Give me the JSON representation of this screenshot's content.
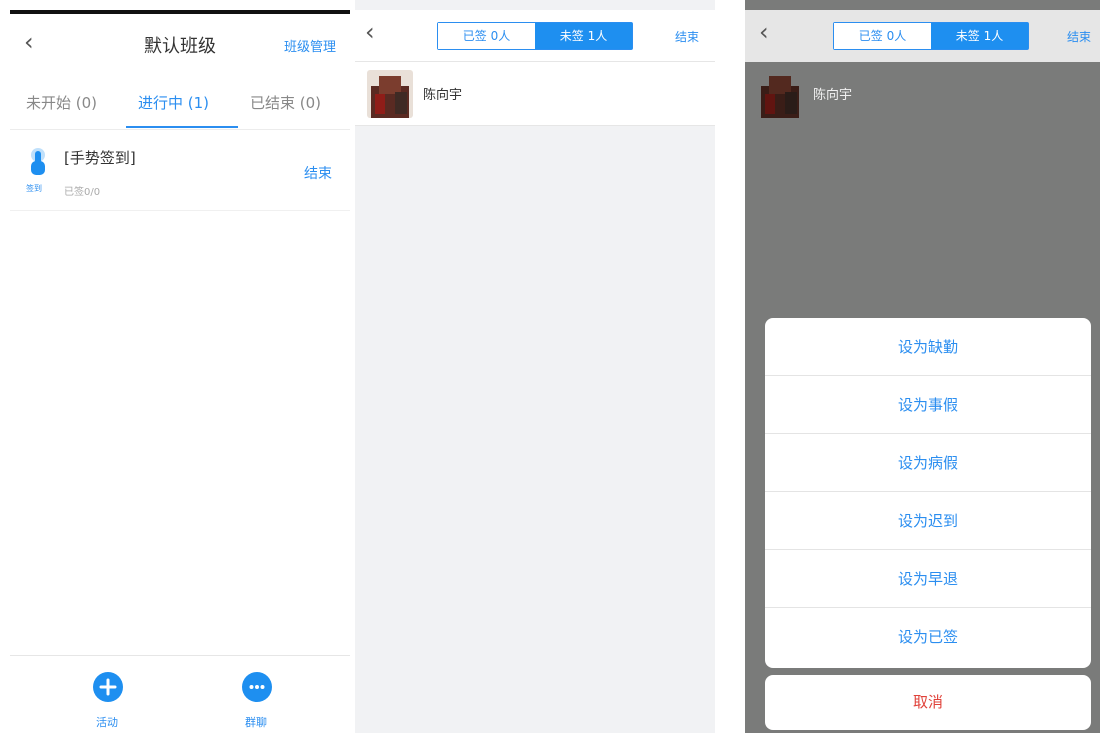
{
  "panel1": {
    "back_icon": "chevron-left-icon",
    "title": "默认班级",
    "manage_label": "班级管理",
    "tabs": [
      {
        "label": "未开始 (0)"
      },
      {
        "label": "进行中 (1)"
      },
      {
        "label": "已结束 (0)"
      }
    ],
    "activity": {
      "icon": "hand-tap-icon",
      "icon_label": "签到",
      "title": "[手势签到]",
      "sub": "已签0/0",
      "end_label": "结束"
    },
    "bottom": {
      "activity_label": "活动",
      "group_label": "群聊",
      "activity_icon": "plus-circle-icon",
      "group_icon": "chat-bubble-icon"
    }
  },
  "panel2": {
    "back_icon": "chevron-left-icon",
    "seg_signed": "已签 0人",
    "seg_unsigned": "未签 1人",
    "end_label": "结束",
    "student": {
      "name": "陈向宇",
      "avatar_icon": "avatar"
    }
  },
  "panel3": {
    "back_icon": "chevron-left-icon",
    "seg_signed": "已签 0人",
    "seg_unsigned": "未签 1人",
    "end_label": "结束",
    "student": {
      "name": "陈向宇"
    },
    "actions": [
      {
        "label": "设为缺勤"
      },
      {
        "label": "设为事假"
      },
      {
        "label": "设为病假"
      },
      {
        "label": "设为迟到"
      },
      {
        "label": "设为早退"
      },
      {
        "label": "设为已签"
      }
    ],
    "cancel_label": "取消"
  },
  "colors": {
    "accent": "#1e8ff0",
    "danger": "#e0423a",
    "overlay": "#7a7b7a"
  }
}
